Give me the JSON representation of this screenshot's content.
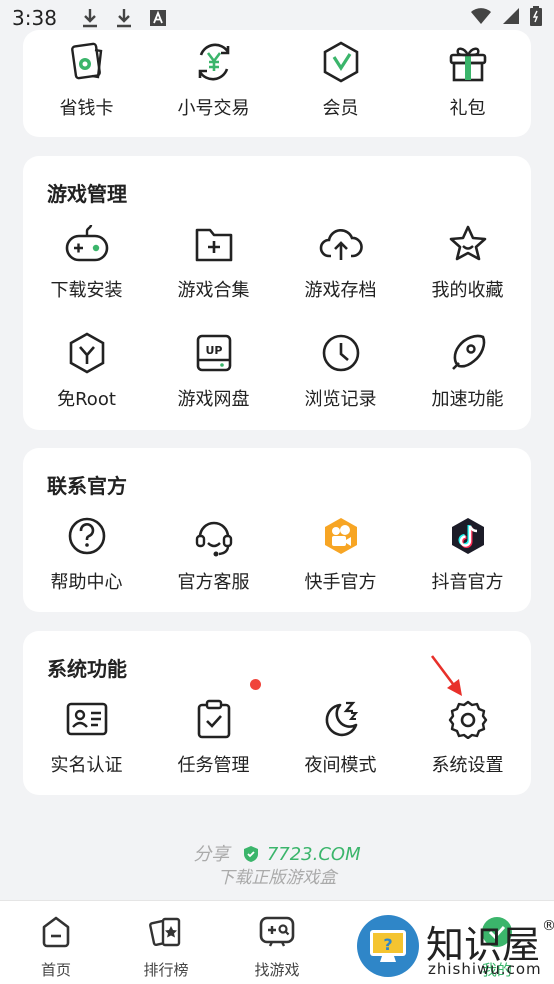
{
  "status_bar": {
    "time": "3:38"
  },
  "top_row": {
    "items": [
      {
        "label": "省钱卡"
      },
      {
        "label": "小号交易"
      },
      {
        "label": "会员"
      },
      {
        "label": "礼包"
      }
    ]
  },
  "game_management": {
    "title": "游戏管理",
    "items": [
      {
        "label": "下载安装"
      },
      {
        "label": "游戏合集"
      },
      {
        "label": "游戏存档"
      },
      {
        "label": "我的收藏"
      },
      {
        "label": "免Root"
      },
      {
        "label": "游戏网盘"
      },
      {
        "label": "浏览记录"
      },
      {
        "label": "加速功能"
      }
    ]
  },
  "contact_official": {
    "title": "联系官方",
    "items": [
      {
        "label": "帮助中心"
      },
      {
        "label": "官方客服"
      },
      {
        "label": "快手官方"
      },
      {
        "label": "抖音官方"
      }
    ]
  },
  "system_functions": {
    "title": "系统功能",
    "items": [
      {
        "label": "实名认证"
      },
      {
        "label": "任务管理"
      },
      {
        "label": "夜间模式"
      },
      {
        "label": "系统设置"
      }
    ]
  },
  "share": {
    "prefix": "分享",
    "brand": "7723.COM",
    "tagline": "下载正版游戏盒"
  },
  "tabbar": {
    "items": [
      {
        "label": "首页"
      },
      {
        "label": "排行榜"
      },
      {
        "label": "找游戏"
      },
      {
        "label": "我的"
      }
    ]
  },
  "watermark": {
    "text": "知识屋",
    "sub": "zhishiwu.com",
    "reg": "®"
  },
  "colors": {
    "accent": "#3bb56b",
    "red_dot": "#f0443b",
    "arrow": "#e8302a",
    "kuaishou": "#f7a524",
    "douyin": "#1c1c28"
  }
}
